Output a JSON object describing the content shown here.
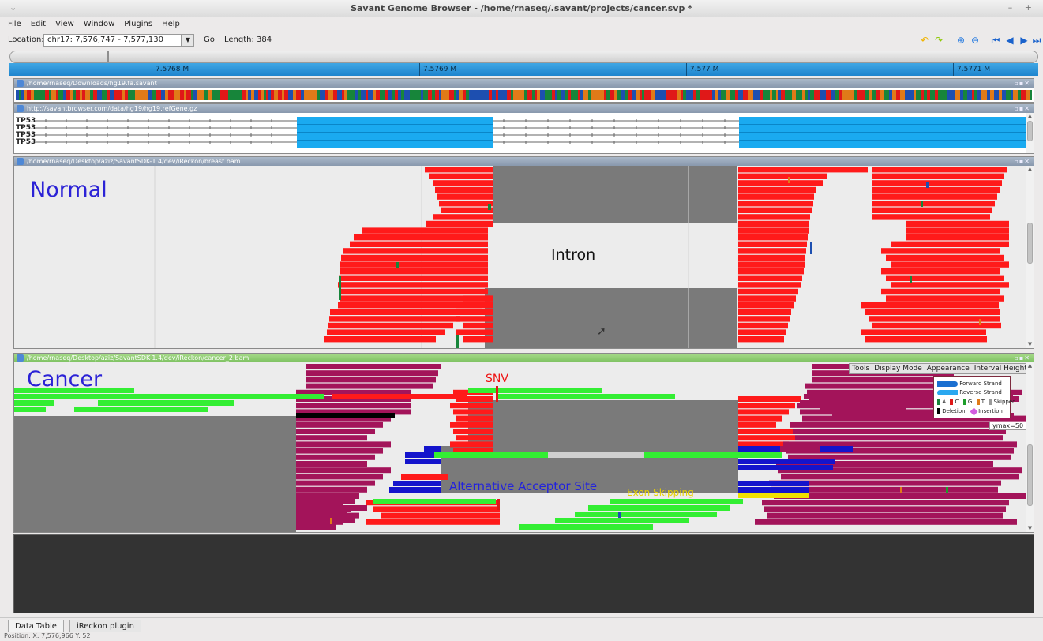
{
  "window": {
    "title": "Savant Genome Browser - /home/rnaseq/.savant/projects/cancer.svp *",
    "controls": "– +"
  },
  "menu": [
    "File",
    "Edit",
    "View",
    "Window",
    "Plugins",
    "Help"
  ],
  "location": {
    "label": "Location:",
    "value": "chr17: 7,576,747 - 7,577,130",
    "go_label": "Go",
    "length_label": "Length: 384"
  },
  "toolbar_icons": [
    "undo-icon",
    "redo-icon",
    "zoom-in-icon",
    "zoom-out-icon",
    "go-start-icon",
    "pan-left-icon",
    "pan-right-icon",
    "go-end-icon"
  ],
  "ruler": {
    "ticks": [
      "7.5768 M",
      "7.5769 M",
      "7.577 M",
      "7.5771 M"
    ]
  },
  "tracks": {
    "sequence": {
      "title": "/home/rnaseq/Downloads/hg19.fa.savant"
    },
    "refgene": {
      "title": "http://savantbrowser.com/data/hg19/hg19.refGene.gz",
      "genes": [
        "TP53",
        "TP53",
        "TP53",
        "TP53"
      ]
    },
    "normal": {
      "title": "/home/rnaseq/Desktop/aziz/SavantSDK-1.4/dev/iReckon/breast.bam",
      "label": "Normal",
      "annotation": "Intron"
    },
    "cancer": {
      "title": "/home/rnaseq/Desktop/aziz/SavantSDK-1.4/dev/iReckon/cancer_2.bam",
      "label": "Cancer",
      "annotations": {
        "snv": "SNV",
        "acceptor": "Alternative  Acceptor Site",
        "skipping": "Exon Skipping"
      },
      "track_menu": [
        "Tools",
        "Display Mode",
        "Appearance",
        "Interval Height"
      ],
      "legend": {
        "forward": "Forward Strand",
        "reverse": "Reverse Strand",
        "a": "A",
        "c": "C",
        "g": "G",
        "t": "T",
        "skipped": "Skipped",
        "deletion": "Deletion",
        "insertion": "Insertion"
      },
      "ymax": "ymax=50"
    }
  },
  "colors": {
    "read": "#ff1a1a",
    "cancer_read": "#a3145a",
    "snv_read": "#33ee33",
    "alt_read": "#1414cc",
    "intron_gray": "#7a7a7a",
    "exon": "#1aaaf0",
    "ruler": "#2b94d8",
    "cancer_label": "#2b22d6",
    "snv_text": "#ee1111",
    "acceptor_text": "#2222dd",
    "skipping_text": "#e8d000"
  },
  "bottom_tabs": [
    "Data Table",
    "iReckon plugin"
  ],
  "status": "Position: X: 7,576,966 Y: 52"
}
